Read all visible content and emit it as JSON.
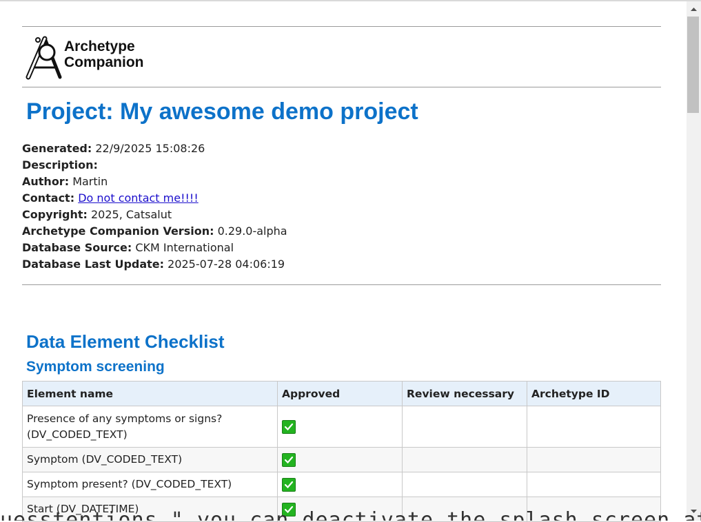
{
  "logo": {
    "line1": "Archetype",
    "line2": "Companion"
  },
  "page_title": "Project: My awesome demo project",
  "meta": {
    "generated_label": "Generated:",
    "generated_value": "22/9/2025 15:08:26",
    "description_label": "Description:",
    "description_value": "",
    "author_label": "Author:",
    "author_value": "Martin",
    "contact_label": "Contact:",
    "contact_value": "Do not contact me!!!!",
    "copyright_label": "Copyright:",
    "copyright_value": "2025, Catsalut",
    "version_label": "Archetype Companion Version:",
    "version_value": "0.29.0-alpha",
    "db_source_label": "Database Source:",
    "db_source_value": "CKM International",
    "db_update_label": "Database Last Update:",
    "db_update_value": "2025-07-28 04:06:19"
  },
  "section_title": "Data Element Checklist",
  "subsection_title": "Symptom screening",
  "table": {
    "headers": [
      "Element name",
      "Approved",
      "Review necessary",
      "Archetype ID"
    ],
    "rows": [
      {
        "name": "Presence of any symptoms or signs? (DV_CODED_TEXT)",
        "approved": true,
        "review": "",
        "archetype_id": ""
      },
      {
        "name": "Symptom (DV_CODED_TEXT)",
        "approved": true,
        "review": "",
        "archetype_id": ""
      },
      {
        "name": "Symptom present? (DV_CODED_TEXT)",
        "approved": true,
        "review": "",
        "archetype_id": ""
      },
      {
        "name": "Start (DV_DATETIME)",
        "approved": true,
        "review": "",
        "archetype_id": ""
      }
    ]
  },
  "overlay_text": "uesstentions \" you can deactivate the splash screen at",
  "colors": {
    "heading": "#0d72c9",
    "link": "#1a0dcc",
    "check": "#23b320",
    "header_bg": "#e6f0fa"
  },
  "icons": {
    "check": "checkbox-checked-icon",
    "logo": "magnifier-A-logo-icon",
    "scroll_up": "arrow-up-icon",
    "scroll_down": "arrow-down-icon"
  }
}
